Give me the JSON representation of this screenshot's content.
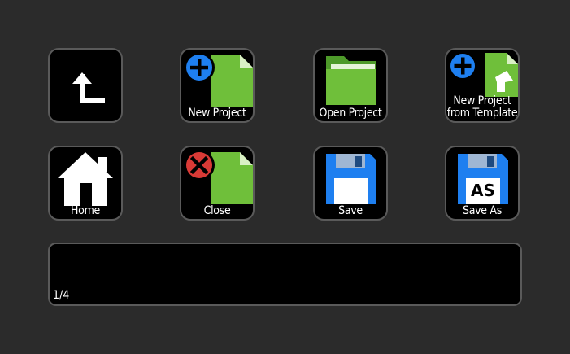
{
  "buttons": {
    "back": {
      "label": ""
    },
    "new_project": {
      "label": "New Project"
    },
    "open_project": {
      "label": "Open Project"
    },
    "new_from_template": {
      "line1": "New Project",
      "line2": "from Template"
    },
    "home": {
      "label": "Home"
    },
    "close": {
      "label": "Close"
    },
    "save": {
      "label": "Save"
    },
    "save_as": {
      "label": "Save As",
      "badge": "AS"
    }
  },
  "status": {
    "page": "1/4"
  },
  "colors": {
    "background": "#2b2b2b",
    "tile": "#000000",
    "tile_border": "#5a5a5a",
    "doc_green": "#6fbf3a",
    "folder_green": "#6fbf3a",
    "plus_blue": "#1e7ff0",
    "close_red": "#d93a36",
    "floppy_blue": "#1e7ff0"
  },
  "icons": {
    "back": "return-arrow-icon",
    "new_project": "new-document-icon",
    "open_project": "folder-icon",
    "new_from_template": "template-document-icon",
    "home": "home-icon",
    "close": "close-document-icon",
    "save": "floppy-disk-icon",
    "save_as": "floppy-disk-as-icon"
  }
}
